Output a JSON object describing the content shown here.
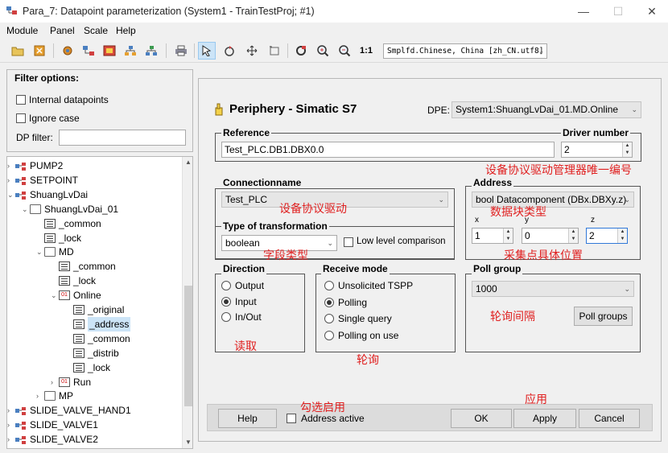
{
  "window": {
    "title": "Para_7: Datapoint parameterization (System1 - TrainTestProj; #1)",
    "minimize_glyph": "—",
    "maximize_glyph": "☐",
    "close_glyph": "✕"
  },
  "menu": [
    "Module",
    "Panel",
    "Scale",
    "Help"
  ],
  "toolbar": {
    "one_to_one_label": "1:1",
    "language_value": "Smplfd.Chinese, China [zh_CN.utf8]"
  },
  "filter": {
    "title": "Filter options:",
    "internal_label": "Internal datapoints",
    "ignore_case_label": "Ignore case",
    "dp_filter_label": "DP filter:",
    "dp_filter_value": ""
  },
  "tree": [
    {
      "label": "PUMP2",
      "level": 1,
      "exp": "›",
      "icon": "type"
    },
    {
      "label": "SETPOINT",
      "level": 1,
      "exp": "›",
      "icon": "type"
    },
    {
      "label": "ShuangLvDai",
      "level": 1,
      "exp": "⌄",
      "icon": "type"
    },
    {
      "label": "ShuangLvDai_01",
      "level": 2,
      "exp": "⌄",
      "icon": "folder"
    },
    {
      "label": "_common",
      "level": 3,
      "exp": "",
      "icon": "dp"
    },
    {
      "label": "_lock",
      "level": 3,
      "exp": "",
      "icon": "dp"
    },
    {
      "label": "MD",
      "level": 3,
      "exp": "⌄",
      "icon": "folder"
    },
    {
      "label": "_common",
      "level": 4,
      "exp": "",
      "icon": "dp"
    },
    {
      "label": "_lock",
      "level": 4,
      "exp": "",
      "icon": "dp"
    },
    {
      "label": "Online",
      "level": 4,
      "exp": "⌄",
      "icon": "01"
    },
    {
      "label": "_original",
      "level": 5,
      "exp": "",
      "icon": "dp"
    },
    {
      "label": "_address",
      "level": 5,
      "exp": "",
      "icon": "dp",
      "selected": true
    },
    {
      "label": "_common",
      "level": 5,
      "exp": "",
      "icon": "dp"
    },
    {
      "label": "_distrib",
      "level": 5,
      "exp": "",
      "icon": "dp"
    },
    {
      "label": "_lock",
      "level": 5,
      "exp": "",
      "icon": "dp"
    },
    {
      "label": "Run",
      "level": 4,
      "exp": "›",
      "icon": "01"
    },
    {
      "label": "MP",
      "level": 3,
      "exp": "›",
      "icon": "folder"
    },
    {
      "label": "SLIDE_VALVE_HAND1",
      "level": 1,
      "exp": "›",
      "icon": "type"
    },
    {
      "label": "SLIDE_VALVE1",
      "level": 1,
      "exp": "›",
      "icon": "type"
    },
    {
      "label": "SLIDE_VALVE2",
      "level": 1,
      "exp": "›",
      "icon": "type"
    }
  ],
  "header": {
    "title": "Periphery - Simatic S7",
    "dpe_label": "DPE:",
    "dpe_value": "System1:ShuangLvDai_01.MD.Online"
  },
  "reference": {
    "title": "Reference",
    "value": "Test_PLC.DB1.DBX0.0"
  },
  "driver": {
    "title": "Driver number",
    "value": "2"
  },
  "connection": {
    "title": "Connectionname",
    "value": "Test_PLC"
  },
  "address": {
    "title": "Address",
    "value": "bool Datacomponent (DBx.DBXy.z)",
    "x_label": "x",
    "x_value": "1",
    "y_label": "y",
    "y_value": "0",
    "z_label": "z",
    "z_value": "2"
  },
  "transformation": {
    "title": "Type of transformation",
    "value": "boolean",
    "low_level_label": "Low level comparison"
  },
  "direction": {
    "title": "Direction",
    "options": [
      "Output",
      "Input",
      "In/Out"
    ],
    "selected": 1
  },
  "receive": {
    "title": "Receive mode",
    "options": [
      "Unsolicited TSPP",
      "Polling",
      "Single query",
      "Polling on use"
    ],
    "selected": 1
  },
  "poll": {
    "title": "Poll group",
    "value": "1000",
    "button": "Poll groups"
  },
  "footer": {
    "help": "Help",
    "address_active": "Address active",
    "ok": "OK",
    "apply": "Apply",
    "cancel": "Cancel"
  },
  "annotations": {
    "driver_manager": "设备协议驱动管理器唯一编号",
    "protocol_driver": "设备协议驱动",
    "block_type": "数据块类型",
    "field_type": "字段类型",
    "point_position": "采集点具体位置",
    "poll_interval": "轮询间隔",
    "read": "读取",
    "polling": "轮询",
    "check_enable": "勾选启用",
    "apply": "应用"
  },
  "colors": {
    "selection": "#cce4f7",
    "annotation": "#e02020",
    "panel_bg": "#f0f0f0",
    "footer_bg": "#dcdcdc"
  }
}
